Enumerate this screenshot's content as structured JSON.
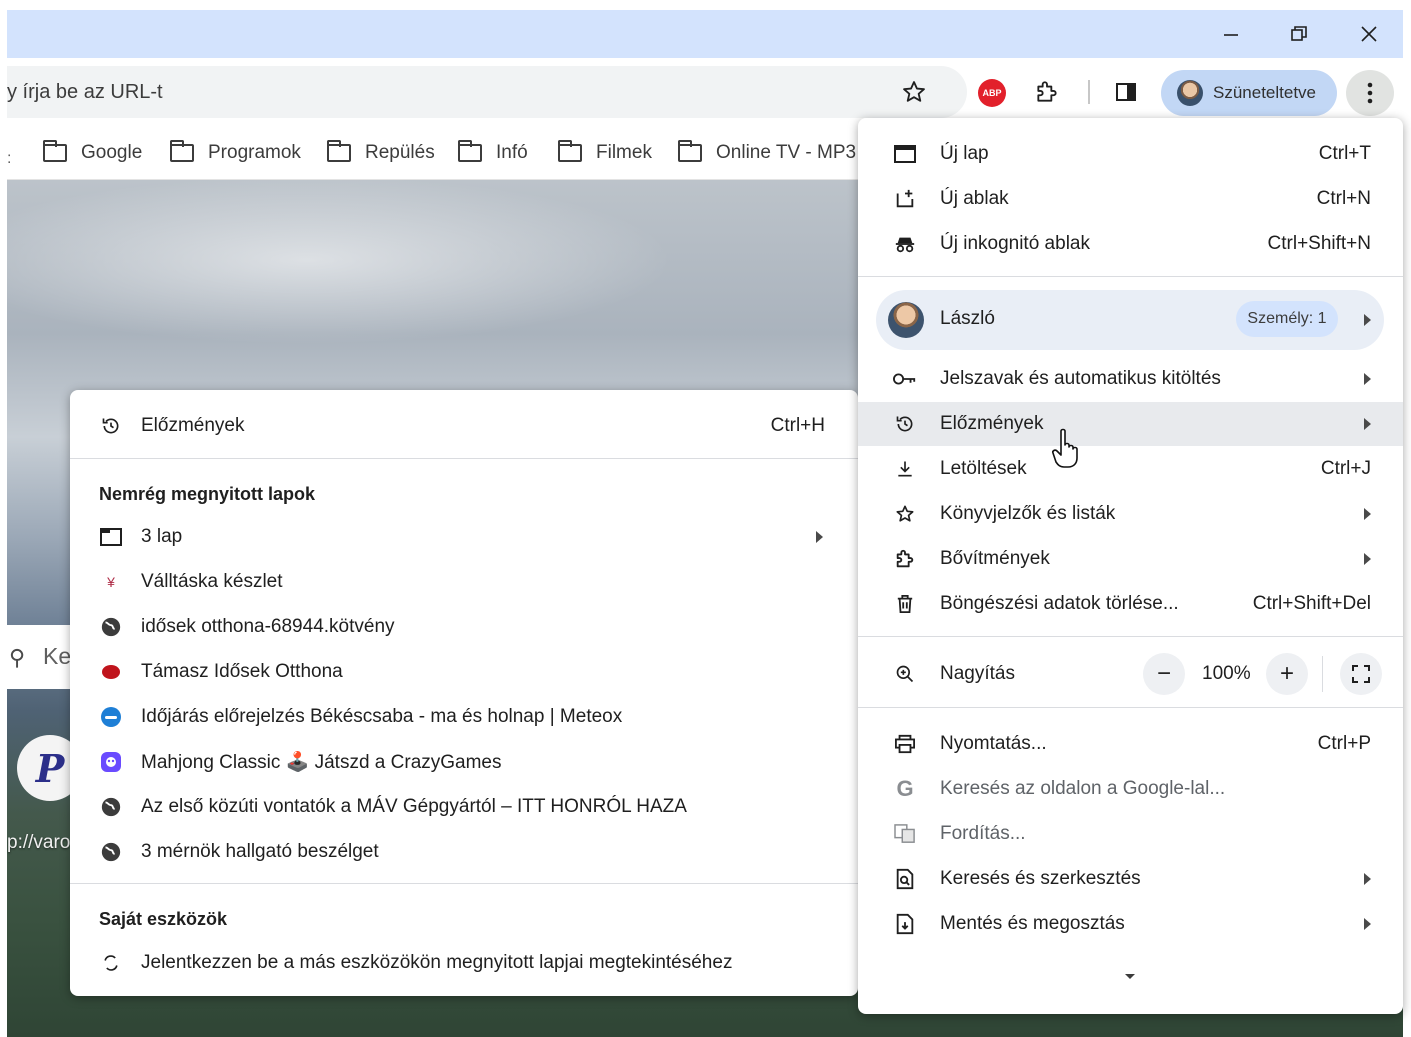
{
  "omnibox": {
    "placeholder": "y írja be az URL-t"
  },
  "toolbar": {
    "profile_status": "Szüneteltetve",
    "abp_label": "ABP"
  },
  "bookmarks": {
    "edge_glyph": ":",
    "items": [
      {
        "label": "Google"
      },
      {
        "label": "Programok"
      },
      {
        "label": "Repülés"
      },
      {
        "label": "Infó"
      },
      {
        "label": "Filmek"
      },
      {
        "label": "Online TV - MP3"
      }
    ]
  },
  "page": {
    "search_partial": "Ke",
    "tile_letter": "P",
    "tile_url_partial": "p://varo"
  },
  "history_submenu": {
    "header_label": "Előzmények",
    "header_shortcut": "Ctrl+H",
    "recent_title": "Nemrég megnyitott lapok",
    "items": [
      {
        "label": "3 lap",
        "icon": "tab-icon"
      },
      {
        "label": "Válltáska készlet",
        "icon": "site-favicon"
      },
      {
        "label": "idősek otthona-68944.kötvény",
        "icon": "globe-icon"
      },
      {
        "label": "Támasz Idősek Otthona",
        "icon": "site-favicon"
      },
      {
        "label": "Időjárás előrejelzés Békéscsaba - ma és holnap | Meteox",
        "icon": "weather-favicon"
      },
      {
        "label": "Mahjong Classic 🕹️ Játszd a CrazyGames",
        "icon": "crazygames-favicon"
      },
      {
        "label": "Az első közúti vontatók a MÁV Gépgyártól – ITT HONRÓL HAZA",
        "icon": "globe-icon"
      },
      {
        "label": "3 mérnök hallgató beszélget",
        "icon": "globe-icon"
      }
    ],
    "devices_title": "Saját eszközök",
    "devices_text": "Jelentkezzen be a más eszközökön megnyitott lapjai megtekintéséhez"
  },
  "main_menu": {
    "new_tab": {
      "label": "Új lap",
      "shortcut": "Ctrl+T"
    },
    "new_window": {
      "label": "Új ablak",
      "shortcut": "Ctrl+N"
    },
    "incognito": {
      "label": "Új inkognitó ablak",
      "shortcut": "Ctrl+Shift+N"
    },
    "profile": {
      "name": "László",
      "badge": "Személy: 1"
    },
    "passwords": {
      "label": "Jelszavak és automatikus kitöltés"
    },
    "history": {
      "label": "Előzmények"
    },
    "downloads": {
      "label": "Letöltések",
      "shortcut": "Ctrl+J"
    },
    "bookmarks": {
      "label": "Könyvjelzők és listák"
    },
    "extensions": {
      "label": "Bővítmények"
    },
    "clear_data": {
      "label": "Böngészési adatok törlése...",
      "shortcut": "Ctrl+Shift+Del"
    },
    "zoom": {
      "label": "Nagyítás",
      "minus": "−",
      "value": "100%",
      "plus": "+"
    },
    "print": {
      "label": "Nyomtatás...",
      "shortcut": "Ctrl+P"
    },
    "search_google": {
      "label": "Keresés az oldalon a Google-lal...",
      "icon_letter": "G"
    },
    "translate": {
      "label": "Fordítás..."
    },
    "find_edit": {
      "label": "Keresés és szerkesztés"
    },
    "save_share": {
      "label": "Mentés és megosztás"
    }
  }
}
